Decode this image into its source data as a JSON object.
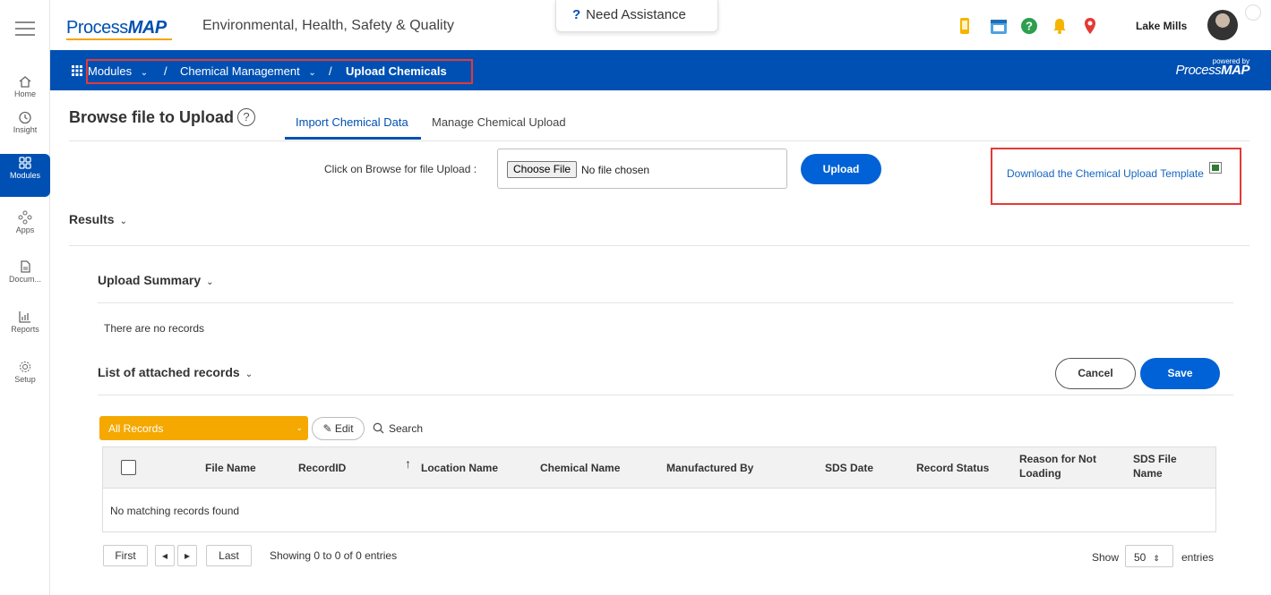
{
  "colors": {
    "brand_blue": "#0050b3",
    "accent_orange": "#f5a800",
    "highlight_red": "#e53935",
    "primary_button": "#0062d6"
  },
  "rail": {
    "menu_icon": "hamburger-icon",
    "items": [
      {
        "label": "Home",
        "icon": "home-icon"
      },
      {
        "label": "Insight",
        "icon": "clock-icon"
      },
      {
        "label": "Modules",
        "icon": "grid-icon",
        "active": true
      },
      {
        "label": "Apps",
        "icon": "apps-icon"
      },
      {
        "label": "Docum...",
        "icon": "document-icon"
      },
      {
        "label": "Reports",
        "icon": "chart-icon"
      },
      {
        "label": "Setup",
        "icon": "gear-icon"
      }
    ]
  },
  "header": {
    "logo_prefix": "Process",
    "logo_suffix": "MAP",
    "app_title": "Environmental, Health, Safety & Quality",
    "assist_label": "Need Assistance",
    "assist_icon": "?",
    "user_name": "Lake Mills",
    "icons": [
      "mobile-icon",
      "calendar-icon",
      "help-icon",
      "bell-icon",
      "location-pin-icon"
    ]
  },
  "bluebar": {
    "breadcrumb": {
      "modules": "Modules",
      "separator": "/",
      "chemical_management": "Chemical Management",
      "current": "Upload Chemicals"
    },
    "powered_by": "powered by",
    "powered_logo_prefix": "Process",
    "powered_logo_suffix": "MAP"
  },
  "page": {
    "title": "Browse file to Upload",
    "help": "?",
    "tabs": [
      {
        "label": "Import Chemical Data",
        "active": true
      },
      {
        "label": "Manage Chemical Upload",
        "active": false
      }
    ],
    "browse_label": "Click on Browse for file Upload :",
    "choose_file": "Choose File",
    "no_file": "No file chosen",
    "upload_button": "Upload",
    "download_link": "Download the Chemical Upload Template",
    "results_title": "Results",
    "upload_summary_title": "Upload Summary",
    "no_records": "There are no records",
    "attached_title": "List of attached records",
    "cancel_button": "Cancel",
    "save_button": "Save",
    "records_filter": "All Records",
    "edit_button": "Edit",
    "search_label": "Search",
    "table": {
      "columns": [
        "File Name",
        "RecordID",
        "Location Name",
        "Chemical Name",
        "Manufactured By",
        "SDS Date",
        "Record Status",
        "Reason for Not Loading",
        "SDS File Name"
      ],
      "empty_message": "No matching records found"
    },
    "pager": {
      "first": "First",
      "prev": "◂",
      "next": "▸",
      "last": "Last",
      "info": "Showing 0 to 0 of 0 entries",
      "show": "Show",
      "page_size": "50",
      "entries": "entries"
    }
  }
}
